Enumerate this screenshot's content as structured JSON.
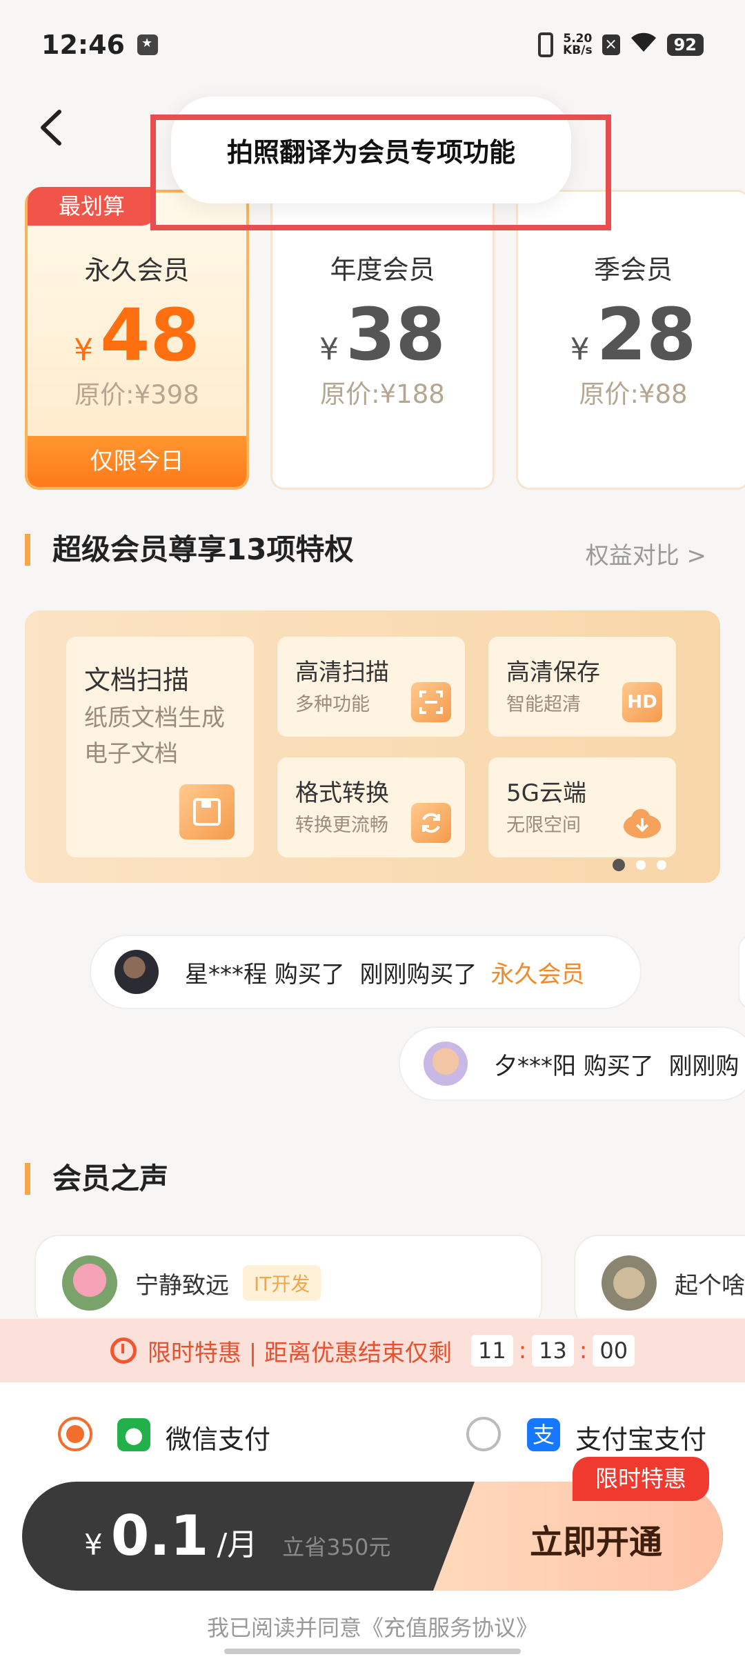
{
  "status": {
    "time": "12:46",
    "speed_top": "5.20",
    "speed_bottom": "KB/s",
    "battery": "92"
  },
  "toast": {
    "text": "拍照翻译为会员专项功能"
  },
  "plans": [
    {
      "tag": "最划算",
      "name": "永久会员",
      "yen": "¥",
      "price": "48",
      "original": "原价:¥398",
      "limit": "仅限今日"
    },
    {
      "name": "年度会员",
      "yen": "¥",
      "price": "38",
      "original": "原价:¥188"
    },
    {
      "name": "季会员",
      "yen": "¥",
      "price": "28",
      "original": "原价:¥88"
    }
  ],
  "privileges": {
    "title": "超级会员尊享13项特权",
    "compare": "权益对比 >",
    "items": [
      {
        "title": "文档扫描",
        "sub": "纸质文档生成电子文档"
      },
      {
        "title": "高清扫描",
        "sub": "多种功能"
      },
      {
        "title": "高清保存",
        "sub": "智能超清",
        "icon": "HD"
      },
      {
        "title": "格式转换",
        "sub": "转换更流畅"
      },
      {
        "title": "5G云端",
        "sub": "无限空间"
      }
    ]
  },
  "purchases": [
    {
      "user": "星***程",
      "bought": "购买了",
      "when": "刚刚购买了",
      "plan": "永久会员"
    },
    {
      "user": "夕***阳",
      "bought": "购买了",
      "when": "刚刚购"
    }
  ],
  "voices": {
    "title": "会员之声",
    "reviews": [
      {
        "name": "宁静致远",
        "tag": "IT开发"
      },
      {
        "name": "起个啥"
      }
    ]
  },
  "promo": {
    "text": "限时特惠 | 距离优惠结束仅剩",
    "h": "11",
    "m": "13",
    "s": "00",
    "sep": ":"
  },
  "payment": {
    "wechat": "微信支付",
    "alipay": "支付宝支付",
    "alipay_icon": "支"
  },
  "cta": {
    "yen": "¥",
    "price": "0.1",
    "unit": "/月",
    "save": "立省350元",
    "button": "立即开通",
    "badge": "限时特惠"
  },
  "agreement": "我已阅读并同意《充值服务协议》",
  "colors": {
    "accent": "#ff6f10",
    "promo_red": "#f03a2f",
    "dark": "#3a3a3a"
  }
}
